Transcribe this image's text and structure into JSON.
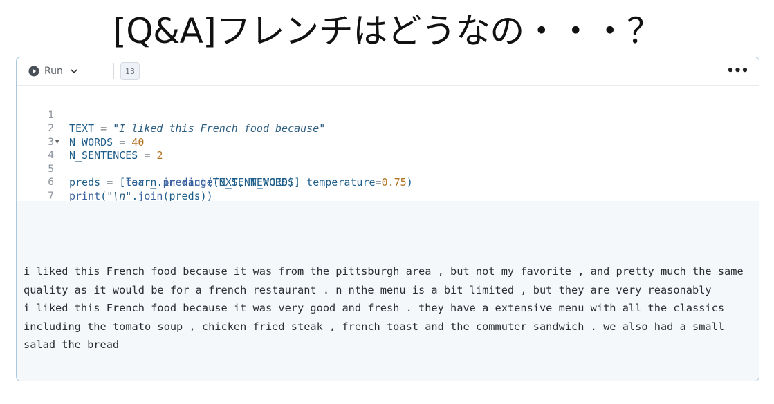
{
  "slide": {
    "title": "[Q&A]フレンチはどうなの・・・？"
  },
  "toolbar": {
    "run_label": "Run",
    "execution_count": "13",
    "more_label": "•••"
  },
  "editor": {
    "line_numbers": [
      "1",
      "2",
      "3",
      "4",
      "5",
      "6",
      "7"
    ],
    "lines": [
      "TEXT = \"I liked this French food because\"",
      "N_WORDS = 40",
      "N_SENTENCES = 2",
      "preds = [learn.predict(TEXT, N_WORDS, temperature=0.75)",
      "         for _ in range(N_SENTENCES)]",
      "print(\"\\n\".join(preds))",
      ""
    ]
  },
  "output": {
    "text": "i liked this French food because it was from the pittsburgh area , but not my favorite , and pretty much the same quality as it would be for a french restaurant . n nthe menu is a bit limited , but they are very reasonably\ni liked this French food because it was very good and fresh . they have a extensive menu with all the classics including the tomato soup , chicken fried steak , french toast and the commuter sandwich . we also had a small salad the bread"
  },
  "colors": {
    "cell_border": "#a9c8de",
    "output_background": "#f5f8fb",
    "code_text": "#1e5e8a",
    "number": "#b0711e"
  },
  "icons": {
    "run": "play-circle-icon",
    "dropdown": "chevron-down-icon",
    "fold": "fold-triangle-icon",
    "more": "ellipsis-icon"
  }
}
